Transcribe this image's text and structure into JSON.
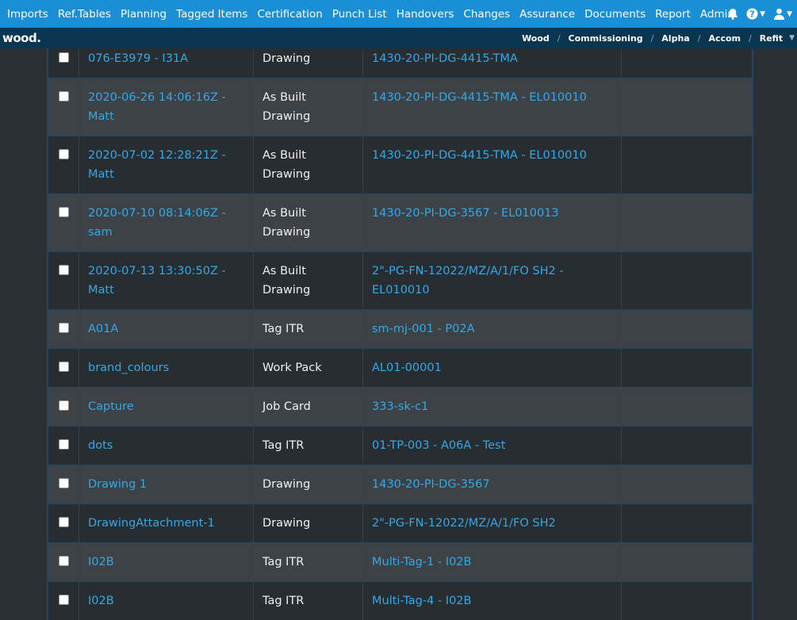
{
  "nav": {
    "items": [
      "Imports",
      "Ref.Tables",
      "Planning",
      "Tagged Items",
      "Certification",
      "Punch List",
      "Handovers",
      "Changes",
      "Assurance",
      "Documents",
      "Report",
      "Admin"
    ],
    "icons": [
      "bell-icon",
      "help-icon",
      "user-icon"
    ],
    "color": "#1a8fd6"
  },
  "subbar": {
    "logo": "wood.",
    "breadcrumbs": [
      "Wood",
      "Commissioning",
      "Alpha",
      "Accom",
      "Refit"
    ],
    "separator": "/",
    "color": "#0b3652"
  },
  "table": {
    "rows": [
      {
        "name": "076-E3979 - I31A",
        "type": "Drawing",
        "ref": "1430-20-PI-DG-4415-TMA",
        "extra": ""
      },
      {
        "name": "2020-06-26 14:06:16Z - Matt",
        "type": "As Built Drawing",
        "ref": "1430-20-PI-DG-4415-TMA - EL010010",
        "extra": ""
      },
      {
        "name": "2020-07-02 12:28:21Z - Matt",
        "type": "As Built Drawing",
        "ref": "1430-20-PI-DG-4415-TMA - EL010010",
        "extra": ""
      },
      {
        "name": "2020-07-10 08:14:06Z - sam",
        "type": "As Built Drawing",
        "ref": "1430-20-PI-DG-3567 - EL010013",
        "extra": ""
      },
      {
        "name": "2020-07-13 13:30:50Z - Matt",
        "type": "As Built Drawing",
        "ref": "2\"-PG-FN-12022/MZ/A/1/FO SH2 - EL010010",
        "extra": ""
      },
      {
        "name": "A01A",
        "type": "Tag ITR",
        "ref": "sm-mj-001 - P02A",
        "extra": ""
      },
      {
        "name": "brand_colours",
        "type": "Work Pack",
        "ref": "AL01-00001",
        "extra": ""
      },
      {
        "name": "Capture",
        "type": "Job Card",
        "ref": "333-sk-c1",
        "extra": ""
      },
      {
        "name": "dots",
        "type": "Tag ITR",
        "ref": "01-TP-003 - A06A - Test",
        "extra": ""
      },
      {
        "name": "Drawing 1",
        "type": "Drawing",
        "ref": "1430-20-PI-DG-3567",
        "extra": ""
      },
      {
        "name": "DrawingAttachment-1",
        "type": "Drawing",
        "ref": "2\"-PG-FN-12022/MZ/A/1/FO SH2",
        "extra": ""
      },
      {
        "name": "I02B",
        "type": "Tag ITR",
        "ref": "Multi-Tag-1 - I02B",
        "extra": ""
      },
      {
        "name": "I02B",
        "type": "Tag ITR",
        "ref": "Multi-Tag-4 - I02B",
        "extra": ""
      }
    ],
    "link_color": "#33a9e8"
  }
}
